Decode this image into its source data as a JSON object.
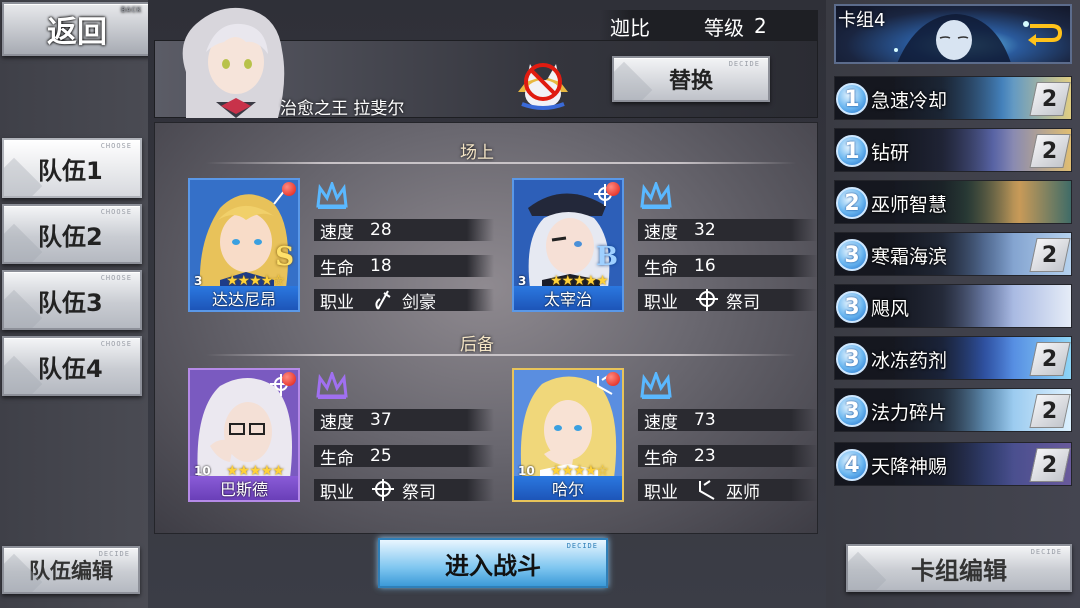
{
  "nav": {
    "back_label": "返回",
    "back_tag": "BACK"
  },
  "teams": [
    {
      "label": "队伍1",
      "tag": "CHOOSE",
      "active": true
    },
    {
      "label": "队伍2",
      "tag": "CHOOSE",
      "active": false
    },
    {
      "label": "队伍3",
      "tag": "CHOOSE",
      "active": false
    },
    {
      "label": "队伍4",
      "tag": "CHOOSE",
      "active": false
    }
  ],
  "team_edit": {
    "label": "队伍编辑",
    "tag": "DECIDE"
  },
  "player": {
    "name": "迦比",
    "level_label": "等级",
    "level": "2",
    "title": "治愈之王 拉斐尔"
  },
  "replace": {
    "label": "替换",
    "tag": "DECIDE"
  },
  "sections": {
    "field": "场上",
    "reserve": "后备"
  },
  "stat_labels": {
    "speed": "速度",
    "hp": "生命",
    "job": "职业"
  },
  "heroes": [
    {
      "name": "达达尼昂",
      "level": "3",
      "stars": "★★★★☆",
      "rank": "S",
      "speed": "28",
      "hp": "18",
      "job": "剑豪",
      "crown_color": "#5ab8ff",
      "frame": "blue"
    },
    {
      "name": "太宰治",
      "level": "3",
      "stars": "★★★★★",
      "rank": "B",
      "speed": "32",
      "hp": "16",
      "job": "祭司",
      "crown_color": "#5ab8ff",
      "frame": "blue"
    },
    {
      "name": "巴斯德",
      "level": "10",
      "stars": "★★★★★",
      "rank": "",
      "speed": "37",
      "hp": "25",
      "job": "祭司",
      "crown_color": "#a070f0",
      "frame": "purple"
    },
    {
      "name": "哈尔",
      "level": "10",
      "stars": "★★★★☆",
      "rank": "",
      "speed": "73",
      "hp": "23",
      "job": "巫师",
      "crown_color": "#5ab8ff",
      "frame": "gold"
    }
  ],
  "battle": {
    "label": "进入战斗",
    "tag": "DECIDE"
  },
  "deck": {
    "title": "卡组4",
    "cards": [
      {
        "cost": "1",
        "name": "急速冷却",
        "count": "2",
        "art": "#4a8fd0"
      },
      {
        "cost": "1",
        "name": "钻研",
        "count": "2",
        "art": "#6a78c8"
      },
      {
        "cost": "2",
        "name": "巫师智慧",
        "count": "",
        "art": "#c89a58"
      },
      {
        "cost": "3",
        "name": "寒霜海滨",
        "count": "2",
        "art": "#6a8cc0"
      },
      {
        "cost": "3",
        "name": "飓风",
        "count": "",
        "art": "#8aa0d8"
      },
      {
        "cost": "3",
        "name": "冰冻药剂",
        "count": "2",
        "art": "#3a6ad8"
      },
      {
        "cost": "3",
        "name": "法力碎片",
        "count": "2",
        "art": "#7ab8e8"
      },
      {
        "cost": "4",
        "name": "天降神赐",
        "count": "2",
        "art": "#3a4a88"
      }
    ]
  },
  "deck_edit": {
    "label": "卡组编辑",
    "tag": "DECIDE"
  },
  "colors": {
    "accent_blue": "#5ab8ff",
    "battle_button": "#7fc6f0",
    "red_dot": "#e01b10"
  }
}
